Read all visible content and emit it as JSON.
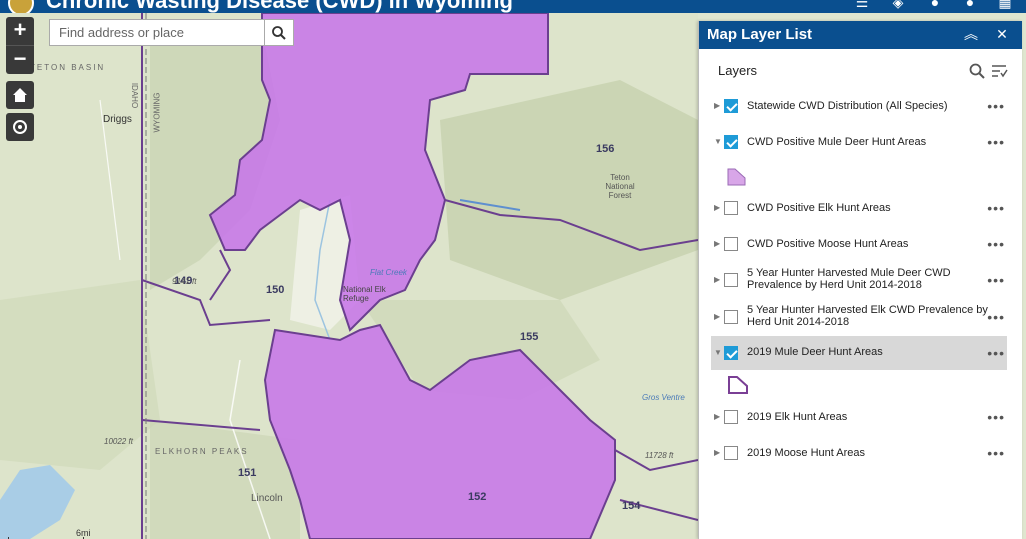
{
  "app": {
    "title": "Chronic Wasting Disease (CWD) in Wyoming"
  },
  "search": {
    "placeholder": "Find address or place"
  },
  "controls": {
    "zoom_in": "+",
    "zoom_out": "−"
  },
  "panel": {
    "title": "Map Layer List",
    "layers_heading": "Layers",
    "layers": [
      {
        "label": "Statewide CWD Distribution (All Species)",
        "checked": true,
        "expanded": false
      },
      {
        "label": "CWD Positive Mule Deer Hunt Areas",
        "checked": true,
        "expanded": true
      },
      {
        "label": "CWD Positive Elk Hunt Areas",
        "checked": false,
        "expanded": false
      },
      {
        "label": "CWD Positive Moose Hunt Areas",
        "checked": false,
        "expanded": false
      },
      {
        "label": "5 Year Hunter Harvested Mule Deer CWD Prevalence by Herd Unit 2014-2018",
        "checked": false,
        "expanded": false
      },
      {
        "label": "5 Year Hunter Harvested Elk CWD Prevalence by Herd Unit 2014-2018",
        "checked": false,
        "expanded": false
      },
      {
        "label": "2019 Mule Deer Hunt Areas",
        "checked": true,
        "expanded": true,
        "selected": true
      },
      {
        "label": "2019 Elk Hunt Areas",
        "checked": false,
        "expanded": false
      },
      {
        "label": "2019 Moose Hunt Areas",
        "checked": false,
        "expanded": false
      }
    ],
    "more_glyph": "•••"
  },
  "map_labels": {
    "hunt_areas": [
      "156",
      "149",
      "150",
      "155",
      "151",
      "152",
      "154"
    ],
    "elevations": [
      "9141 ft",
      "10022 ft",
      "11728 ft"
    ],
    "places": [
      "Driggs",
      "Teton National Forest",
      "National Elk Refuge",
      "Flat Creek",
      "Gros Ventre",
      "Lincoln"
    ],
    "regions": [
      "TETON BASIN",
      "ELKHORN PEAKS"
    ],
    "states": [
      "IDAHO",
      "WYOMING"
    ],
    "scale": "6mi"
  },
  "colors": {
    "header": "#0a4f8f",
    "hunt_area_fill": "#c879e8",
    "hunt_area_stroke": "#6b3f8f",
    "checkbox": "#1e9bd7"
  }
}
